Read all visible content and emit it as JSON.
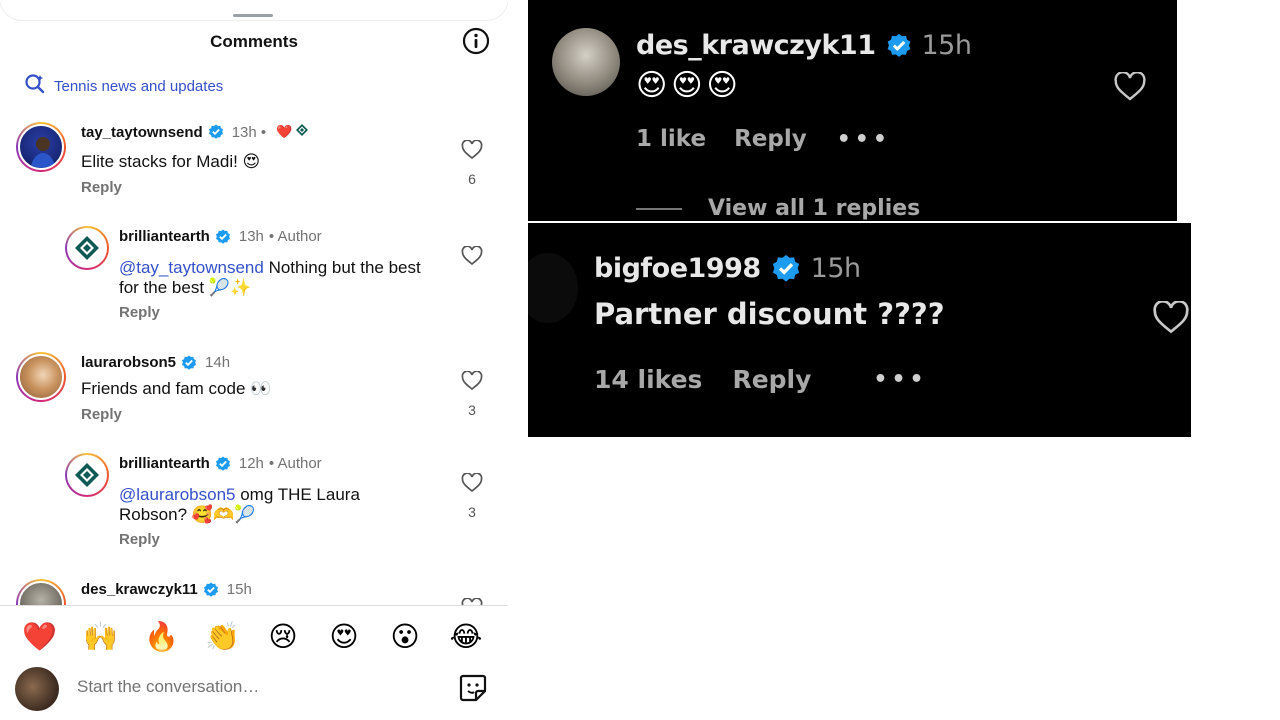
{
  "left_panel": {
    "title": "Comments",
    "topic": "Tennis news and updates",
    "comments": [
      {
        "username": "tay_taytownsend",
        "time": "13h •",
        "text": "Elite stacks for Madi! 😍",
        "reply_label": "Reply",
        "likes": "6",
        "badges": "❤️"
      },
      {
        "username": "brilliantearth",
        "time": "13h",
        "author_tag": "• Author",
        "mention": "@tay_taytownsend",
        "text": " Nothing but the best for the best 🎾✨",
        "reply_label": "Reply",
        "likes": ""
      },
      {
        "username": "laurarobson5",
        "time": "14h",
        "text": "Friends and fam code 👀",
        "reply_label": "Reply",
        "likes": "3"
      },
      {
        "username": "brilliantearth",
        "time": "12h",
        "author_tag": "• Author",
        "mention": "@laurarobson5",
        "text": " omg THE Laura Robson? 🥰🫶🎾",
        "reply_label": "Reply",
        "likes": "3"
      },
      {
        "username": "des_krawczyk11",
        "time": "15h"
      }
    ],
    "emoji_bar": [
      "❤️",
      "🙌",
      "🔥",
      "👏",
      "😢",
      "😍",
      "😮",
      "😂"
    ],
    "composer_placeholder": "Start the conversation…"
  },
  "right_top": {
    "username": "des_krawczyk11",
    "time": "15h",
    "text": "😍😍😍",
    "likes_label": "1 like",
    "reply_label": "Reply",
    "more": "•••",
    "view_replies": "View all 1 replies"
  },
  "right_bottom": {
    "username": "bigfoe1998",
    "time": "15h",
    "text": "Partner discount ????",
    "likes_label": "14 likes",
    "reply_label": "Reply",
    "more": "•••"
  },
  "colors": {
    "link_blue": "#3551c9",
    "verified_blue": "#1d9bf0",
    "heart_red": "#e0245e"
  }
}
